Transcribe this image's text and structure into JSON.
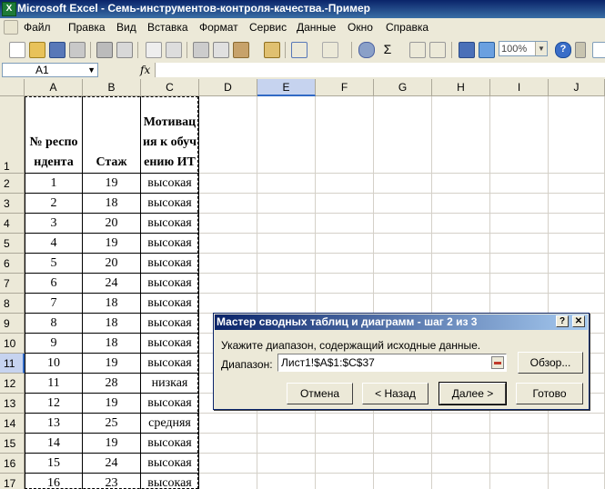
{
  "window": {
    "app_icon": "excel-icon",
    "title": "Microsoft Excel - Семь-инструментов-контроля-качества.-Пример"
  },
  "menu": [
    "Файл",
    "Правка",
    "Вид",
    "Вставка",
    "Формат",
    "Сервис",
    "Данные",
    "Окно",
    "Справка"
  ],
  "toolbar": {
    "zoom": "100%"
  },
  "formula_bar": {
    "name_box": "A1",
    "fx_label": "fx",
    "content": ""
  },
  "sheet": {
    "columns": [
      "A",
      "B",
      "C",
      "D",
      "E",
      "F",
      "G",
      "H",
      "I",
      "J"
    ],
    "selected_column": "E",
    "selected_row": "11",
    "header_row": {
      "row": "1",
      "a": "№ респондента",
      "b": "Стаж",
      "c": "Мотивация к обучению ИТ"
    },
    "rows": [
      {
        "row": "2",
        "a": "1",
        "b": "19",
        "c": "высокая"
      },
      {
        "row": "3",
        "a": "2",
        "b": "18",
        "c": "высокая"
      },
      {
        "row": "4",
        "a": "3",
        "b": "20",
        "c": "высокая"
      },
      {
        "row": "5",
        "a": "4",
        "b": "19",
        "c": "высокая"
      },
      {
        "row": "6",
        "a": "5",
        "b": "20",
        "c": "высокая"
      },
      {
        "row": "7",
        "a": "6",
        "b": "24",
        "c": "высокая"
      },
      {
        "row": "8",
        "a": "7",
        "b": "18",
        "c": "высокая"
      },
      {
        "row": "9",
        "a": "8",
        "b": "18",
        "c": "высокая"
      },
      {
        "row": "10",
        "a": "9",
        "b": "18",
        "c": "высокая"
      },
      {
        "row": "11",
        "a": "10",
        "b": "19",
        "c": "высокая"
      },
      {
        "row": "12",
        "a": "11",
        "b": "28",
        "c": "низкая"
      },
      {
        "row": "13",
        "a": "12",
        "b": "19",
        "c": "высокая"
      },
      {
        "row": "14",
        "a": "13",
        "b": "25",
        "c": "средняя"
      },
      {
        "row": "15",
        "a": "14",
        "b": "19",
        "c": "высокая"
      },
      {
        "row": "16",
        "a": "15",
        "b": "24",
        "c": "высокая"
      },
      {
        "row": "17",
        "a": "16",
        "b": "23",
        "c": "высокая"
      }
    ]
  },
  "dialog": {
    "title": "Мастер сводных таблиц и диаграмм - шаг 2 из 3",
    "help_label": "?",
    "close_label": "✕",
    "prompt": "Укажите диапазон, содержащий исходные данные.",
    "range_label": "Диапазон:",
    "range_value": "Лист1!$A$1:$C$37",
    "browse_label": "Обзор...",
    "cancel_label": "Отмена",
    "back_label": "< Назад",
    "next_label": "Далее >",
    "finish_label": "Готово"
  }
}
